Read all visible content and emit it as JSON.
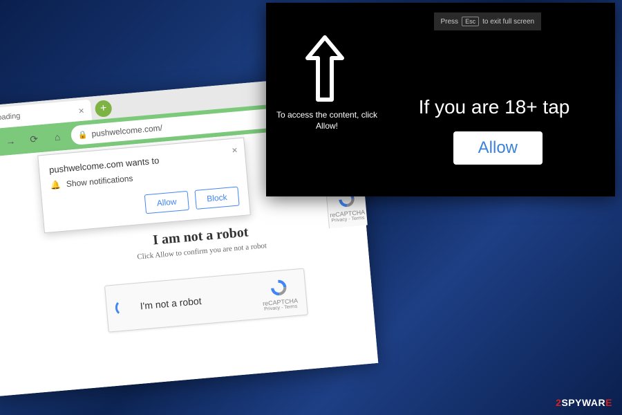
{
  "browser": {
    "tab_label": "Loading",
    "url": "pushwelcome.com/",
    "new_tab": "+"
  },
  "notification": {
    "title": "pushwelcome.com wants to",
    "body": "Show notifications",
    "allow": "Allow",
    "block": "Block"
  },
  "captcha": {
    "title": "I am not a robot",
    "subtitle": "Click Allow to confirm you are not a robot",
    "box_text": "I'm not a robot",
    "brand": "reCAPTCHA",
    "links": "Privacy - Terms"
  },
  "overlay": {
    "esc_pre": "Press",
    "esc_key": "Esc",
    "esc_post": "to exit full screen",
    "access_text": "To access the content, click Allow!",
    "age_text": "If you are 18+ tap",
    "allow_btn": "Allow"
  },
  "watermark": {
    "pre": "2",
    "main": "SPYWAR",
    "suf": "E"
  }
}
